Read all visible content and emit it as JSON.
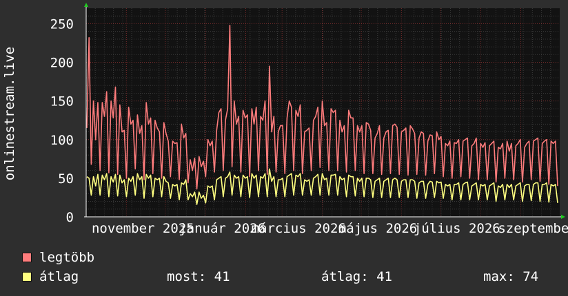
{
  "chart_data": {
    "type": "line",
    "ylabel": "onlinestream.live",
    "ylim": [
      0,
      270
    ],
    "y_ticks": [
      0,
      50,
      100,
      150,
      200,
      250
    ],
    "x_tick_labels": [
      "november 2025",
      "január 2026",
      "március 2026",
      "május 2026",
      "július 2026",
      "szeptember"
    ],
    "x_start": "2025-10-01",
    "x_end": "2026-10-01",
    "grid": true,
    "series": [
      {
        "name": "legtöbb",
        "color": "#ff7c7c",
        "values": [
          115,
          232,
          68,
          150,
          100,
          148,
          60,
          148,
          130,
          162,
          57,
          150,
          128,
          168,
          55,
          145,
          110,
          112,
          50,
          142,
          120,
          125,
          62,
          132,
          108,
          118,
          48,
          148,
          120,
          128,
          56,
          125,
          115,
          110,
          50,
          122,
          108,
          98,
          52,
          98,
          95,
          96,
          48,
          120,
          102,
          108,
          44,
          74,
          60,
          76,
          36,
          78,
          65,
          72,
          52,
          100,
          92,
          98,
          58,
          112,
          135,
          140,
          60,
          125,
          140,
          248,
          65,
          150,
          120,
          130,
          58,
          138,
          128,
          132,
          52,
          140,
          120,
          142,
          60,
          130,
          125,
          150,
          55,
          195,
          110,
          130,
          58,
          110,
          118,
          118,
          56,
          128,
          150,
          142,
          60,
          138,
          130,
          145,
          56,
          110,
          112,
          115,
          60,
          125,
          130,
          142,
          64,
          150,
          118,
          122,
          60,
          140,
          135,
          138,
          60,
          125,
          110,
          118,
          58,
          138,
          128,
          128,
          60,
          118,
          110,
          118,
          56,
          122,
          120,
          112,
          56,
          102,
          108,
          118,
          55,
          102,
          110,
          112,
          56,
          118,
          120,
          116,
          55,
          110,
          112,
          115,
          54,
          118,
          114,
          108,
          55,
          102,
          110,
          108,
          54,
          98,
          106,
          105,
          56,
          110,
          100,
          104,
          52,
          95,
          92,
          98,
          50,
          96,
          95,
          100,
          52,
          98,
          100,
          102,
          50,
          92,
          95,
          102,
          48,
          95,
          90,
          96,
          48,
          92,
          95,
          98,
          45,
          90,
          88,
          95,
          50,
          98,
          85,
          95,
          48,
          92,
          95,
          100,
          45,
          90,
          95,
          98,
          48,
          98,
          100,
          102,
          46,
          95,
          98,
          100,
          42,
          98,
          95,
          98,
          40
        ]
      },
      {
        "name": "átlag",
        "color": "#ffff80",
        "values": [
          52,
          50,
          28,
          52,
          40,
          55,
          28,
          54,
          48,
          56,
          26,
          52,
          45,
          55,
          27,
          54,
          44,
          48,
          26,
          50,
          46,
          52,
          28,
          56,
          48,
          52,
          24,
          55,
          50,
          54,
          26,
          50,
          48,
          50,
          26,
          52,
          46,
          44,
          24,
          42,
          40,
          42,
          22,
          44,
          42,
          48,
          22,
          30,
          26,
          32,
          16,
          32,
          24,
          28,
          18,
          40,
          38,
          40,
          22,
          48,
          50,
          52,
          26,
          50,
          52,
          58,
          28,
          54,
          50,
          52,
          26,
          54,
          50,
          52,
          25,
          56,
          50,
          54,
          26,
          52,
          50,
          56,
          26,
          62,
          46,
          52,
          26,
          48,
          48,
          50,
          26,
          52,
          54,
          56,
          28,
          54,
          52,
          56,
          28,
          48,
          46,
          48,
          28,
          50,
          52,
          55,
          28,
          56,
          48,
          50,
          28,
          54,
          54,
          55,
          28,
          52,
          48,
          50,
          26,
          54,
          52,
          52,
          27,
          50,
          46,
          50,
          26,
          50,
          50,
          48,
          25,
          46,
          48,
          50,
          25,
          46,
          48,
          50,
          25,
          48,
          50,
          48,
          25,
          46,
          48,
          48,
          25,
          48,
          48,
          46,
          24,
          44,
          46,
          46,
          24,
          42,
          46,
          45,
          25,
          46,
          44,
          45,
          24,
          42,
          40,
          42,
          22,
          42,
          42,
          44,
          22,
          42,
          44,
          45,
          22,
          40,
          42,
          44,
          22,
          42,
          40,
          42,
          22,
          40,
          42,
          44,
          20,
          40,
          38,
          42,
          22,
          42,
          38,
          42,
          22,
          40,
          42,
          44,
          20,
          40,
          42,
          42,
          21,
          42,
          44,
          44,
          20,
          42,
          42,
          44,
          19,
          42,
          40,
          42,
          18
        ]
      }
    ],
    "legend": {
      "items": [
        {
          "label": "legtöbb",
          "color": "#ff7c7c"
        },
        {
          "label": "átlag",
          "color": "#ffff80"
        }
      ],
      "stats": {
        "most": "most: 41",
        "atlag": "átlag: 41",
        "max": "max: 74"
      }
    }
  }
}
